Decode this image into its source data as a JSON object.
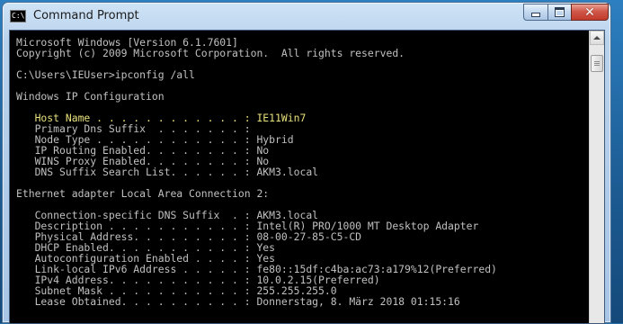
{
  "window": {
    "title": "Command Prompt",
    "icon_text": "C:\\",
    "controls": {
      "minimize": "minimize-icon",
      "maximize": "maximize-icon",
      "close": "close-icon"
    }
  },
  "console": {
    "lines": [
      "Microsoft Windows [Version 6.1.7601]",
      "Copyright (c) 2009 Microsoft Corporation.  All rights reserved.",
      "",
      "C:\\Users\\IEUser>ipconfig /all",
      "",
      "Windows IP Configuration",
      "",
      "   Host Name . . . . . . . . . . . . : IE11Win7",
      "   Primary Dns Suffix  . . . . . . . :",
      "   Node Type . . . . . . . . . . . . : Hybrid",
      "   IP Routing Enabled. . . . . . . . : No",
      "   WINS Proxy Enabled. . . . . . . . : No",
      "   DNS Suffix Search List. . . . . . : AKM3.local",
      "",
      "Ethernet adapter Local Area Connection 2:",
      "",
      "   Connection-specific DNS Suffix  . : AKM3.local",
      "   Description . . . . . . . . . . . : Intel(R) PRO/1000 MT Desktop Adapter",
      "   Physical Address. . . . . . . . . : 08-00-27-85-C5-CD",
      "   DHCP Enabled. . . . . . . . . . . : Yes",
      "   Autoconfiguration Enabled . . . . : Yes",
      "   Link-local IPv6 Address . . . . . : fe80::15df:c4ba:ac73:a179%12(Preferred)",
      "   IPv4 Address. . . . . . . . . . . : 10.0.2.15(Preferred)",
      "   Subnet Mask . . . . . . . . . . . : 255.255.255.0",
      "   Lease Obtained. . . . . . . . . . : Donnerstag, 8. März 2018 01:15:16"
    ],
    "highlighted_line_index": 7,
    "text_color": "#c0c0c0",
    "highlight_color": "#e8e07a",
    "background_color": "#000000"
  },
  "scrollbar": {
    "up_arrow": "up-arrow-icon"
  }
}
